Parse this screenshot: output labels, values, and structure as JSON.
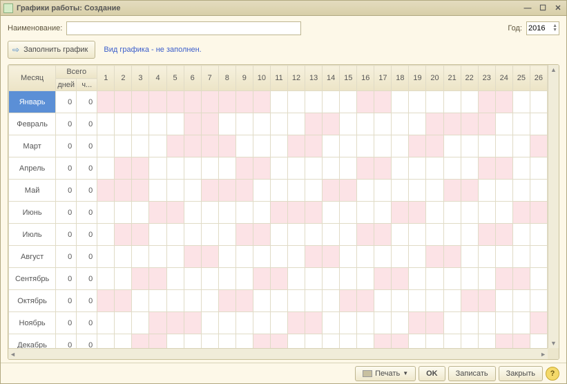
{
  "window": {
    "title": "Графики работы: Создание"
  },
  "form": {
    "name_label": "Наименование:",
    "name_value": "",
    "year_label": "Год:",
    "year_value": "2016",
    "fill_button": "Заполнить график",
    "hint": "Вид графика - не заполнен."
  },
  "table": {
    "header_month": "Месяц",
    "header_total": "Всего",
    "header_days": "дней",
    "header_hours": "ч...",
    "day_numbers": [
      "1",
      "2",
      "3",
      "4",
      "5",
      "6",
      "7",
      "8",
      "9",
      "10",
      "11",
      "12",
      "13",
      "14",
      "15",
      "16",
      "17",
      "18",
      "19",
      "20",
      "21",
      "22",
      "23",
      "24",
      "25",
      "26"
    ],
    "rows": [
      {
        "month": "Январь",
        "days": "0",
        "hours": "0",
        "weekend": [
          1,
          2,
          3,
          4,
          5,
          6,
          7,
          8,
          9,
          10,
          16,
          17,
          23,
          24
        ]
      },
      {
        "month": "Февраль",
        "days": "0",
        "hours": "0",
        "weekend": [
          6,
          7,
          13,
          14,
          20,
          21,
          22,
          23
        ]
      },
      {
        "month": "Март",
        "days": "0",
        "hours": "0",
        "weekend": [
          5,
          6,
          7,
          8,
          12,
          13,
          19,
          20,
          26
        ]
      },
      {
        "month": "Апрель",
        "days": "0",
        "hours": "0",
        "weekend": [
          2,
          3,
          9,
          10,
          16,
          17,
          23,
          24
        ]
      },
      {
        "month": "Май",
        "days": "0",
        "hours": "0",
        "weekend": [
          1,
          2,
          3,
          7,
          8,
          9,
          14,
          15,
          21,
          22
        ]
      },
      {
        "month": "Июнь",
        "days": "0",
        "hours": "0",
        "weekend": [
          4,
          5,
          11,
          12,
          13,
          18,
          19,
          25,
          26
        ]
      },
      {
        "month": "Июль",
        "days": "0",
        "hours": "0",
        "weekend": [
          2,
          3,
          9,
          10,
          16,
          17,
          23,
          24
        ]
      },
      {
        "month": "Август",
        "days": "0",
        "hours": "0",
        "weekend": [
          6,
          7,
          13,
          14,
          20,
          21
        ]
      },
      {
        "month": "Сентябрь",
        "days": "0",
        "hours": "0",
        "weekend": [
          3,
          4,
          10,
          11,
          17,
          18,
          24,
          25
        ]
      },
      {
        "month": "Октябрь",
        "days": "0",
        "hours": "0",
        "weekend": [
          1,
          2,
          8,
          9,
          15,
          16,
          22,
          23
        ]
      },
      {
        "month": "Ноябрь",
        "days": "0",
        "hours": "0",
        "weekend": [
          4,
          5,
          6,
          12,
          13,
          19,
          20,
          26
        ]
      },
      {
        "month": "Декабрь",
        "days": "0",
        "hours": "0",
        "weekend": [
          3,
          4,
          10,
          11,
          17,
          18,
          24,
          25
        ]
      }
    ]
  },
  "footer": {
    "print": "Печать",
    "ok": "OK",
    "save": "Записать",
    "close": "Закрыть"
  }
}
